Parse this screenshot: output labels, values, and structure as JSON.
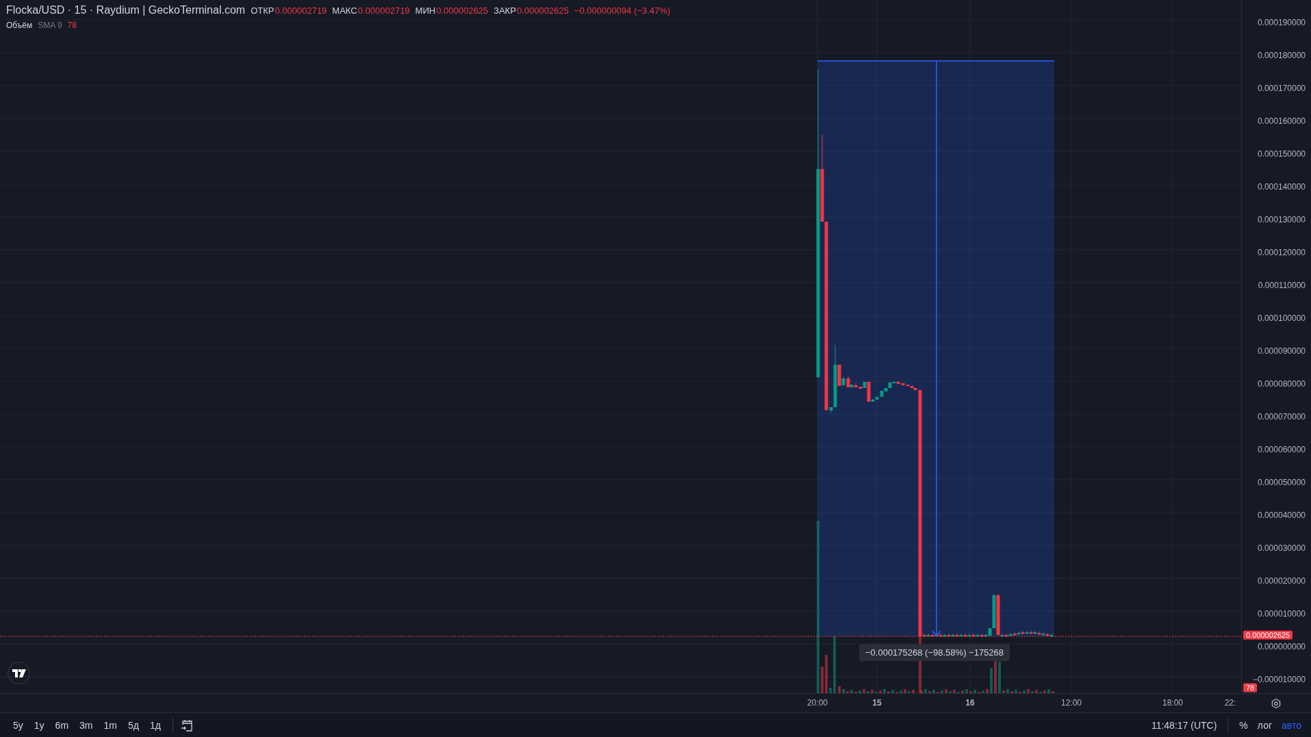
{
  "chart": {
    "symbol": "Flocka/USD · 15 · Raydium | GeckoTerminal.com",
    "ohlc": [
      {
        "label": "ОТКР",
        "value": "0.000002719"
      },
      {
        "label": "МАКС",
        "value": "0.000002719"
      },
      {
        "label": "МИН",
        "value": "0.000002625"
      },
      {
        "label": "ЗАКР",
        "value": "0.000002625"
      }
    ],
    "change": "−0.000000094 (−3.47%)",
    "volume_indicator": {
      "name": "Объём",
      "params": "SMA 9",
      "value": "78"
    },
    "price_axis": [
      "0.000190000",
      "0.000180000",
      "0.000170000",
      "0.000160000",
      "0.000150000",
      "0.000140000",
      "0.000130000",
      "0.000120000",
      "0.000110000",
      "0.000100000",
      "0.000090000",
      "0.000080000",
      "0.000070000",
      "0.000060000",
      "0.000050000",
      "0.000040000",
      "0.000030000",
      "0.000020000",
      "0.000010000",
      "0.000000000",
      "−0.000010000"
    ],
    "last_price": "0.000002625",
    "volume_tag": "78",
    "time_axis": [
      {
        "label": "20:00",
        "bold": false
      },
      {
        "label": "15",
        "bold": true
      },
      {
        "label": "16",
        "bold": true
      },
      {
        "label": "12:00",
        "bold": false
      },
      {
        "label": "18:00",
        "bold": false
      },
      {
        "label": "22:",
        "bold": false
      }
    ],
    "measure": "−0.000175268 (−98.58%) −175268"
  },
  "toolbar": {
    "ranges": [
      "5y",
      "1y",
      "6m",
      "3m",
      "1m",
      "5д",
      "1д"
    ],
    "time": "11:48:17 (UTC)",
    "scale_buttons": [
      {
        "label": "%",
        "selected": false
      },
      {
        "label": "лог",
        "selected": false
      },
      {
        "label": "авто",
        "selected": true
      }
    ]
  }
}
